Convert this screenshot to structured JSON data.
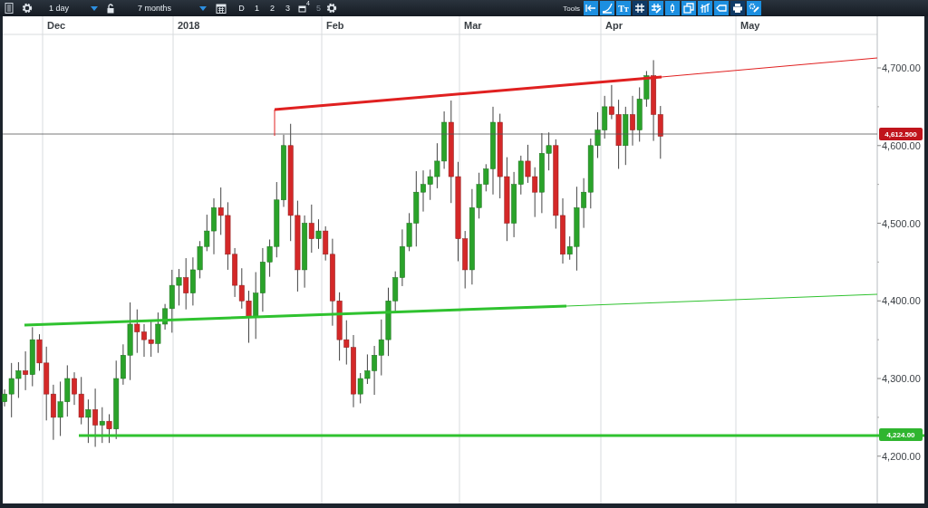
{
  "toolbar": {
    "interval": {
      "value": "1 day"
    },
    "period": {
      "value": "7 months"
    },
    "range_buttons": [
      {
        "label": "D",
        "kind": "text",
        "disabled": false
      },
      {
        "label": "1",
        "kind": "text",
        "disabled": false
      },
      {
        "label": "2",
        "kind": "text",
        "disabled": false
      },
      {
        "label": "3",
        "kind": "text",
        "disabled": false
      },
      {
        "label": "4",
        "kind": "icon",
        "disabled": false
      },
      {
        "label": "5",
        "kind": "text",
        "disabled": true
      }
    ],
    "tools_label": "Tools",
    "tools": [
      {
        "kind": "back",
        "selected": false
      },
      {
        "kind": "curve",
        "selected": false
      },
      {
        "kind": "text",
        "label": "Tт",
        "selected": false
      },
      {
        "kind": "grid",
        "selected": true
      },
      {
        "kind": "pencil",
        "selected": false
      },
      {
        "kind": "candle",
        "selected": false
      },
      {
        "kind": "windows",
        "selected": false
      },
      {
        "kind": "bars",
        "selected": false
      },
      {
        "kind": "tag",
        "selected": false
      },
      {
        "kind": "print",
        "selected": true
      },
      {
        "kind": "settings",
        "selected": false
      }
    ]
  },
  "chart": {
    "time_labels": [
      "Dec",
      "2018",
      "Feb",
      "Mar",
      "Apr",
      "May"
    ],
    "price_labels": [
      "4,700.00",
      "4,600.00",
      "4,500.00",
      "4,400.00",
      "4,300.00",
      "4,200.00"
    ],
    "price_tags": [
      {
        "text": "4,612.500",
        "color": "#c0141c"
      },
      {
        "text": "4,224.00",
        "color": "#2fb52f"
      }
    ]
  }
}
